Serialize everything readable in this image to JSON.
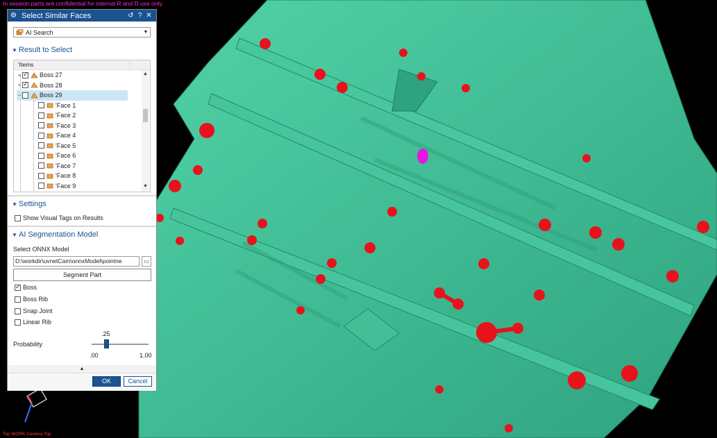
{
  "banner": "In session parts are confidential for internal R and D use only.",
  "viewport_label": "Top WORK Camera Top",
  "colors": {
    "model": "#3fc49a",
    "boss": "#e8121c",
    "selected_face": "#e317e3",
    "title": "#1b5391"
  },
  "dialog": {
    "title": "Select Similar Faces",
    "title_icons": [
      "gear-icon",
      "reset-icon",
      "help-icon",
      "close-icon"
    ],
    "help_glyph": "?",
    "close_glyph": "✕",
    "reset_glyph": "↺",
    "method": "AI Search",
    "result_section": "Result to Select",
    "tree_header": "'Items",
    "tree": [
      {
        "label": "Boss 27",
        "checked": true,
        "expander": "+"
      },
      {
        "label": "Boss 28",
        "checked": true,
        "expander": "+"
      },
      {
        "label": "Boss 29",
        "checked": false,
        "expander": "−",
        "selected": true
      },
      {
        "label": "'Face 1",
        "checked": false
      },
      {
        "label": "'Face 2",
        "checked": false
      },
      {
        "label": "'Face 3",
        "checked": false
      },
      {
        "label": "'Face 4",
        "checked": false
      },
      {
        "label": "'Face 5",
        "checked": false
      },
      {
        "label": "'Face 6",
        "checked": false
      },
      {
        "label": "'Face 7",
        "checked": false
      },
      {
        "label": "'Face 8",
        "checked": false
      },
      {
        "label": "'Face 9",
        "checked": false
      }
    ],
    "settings_section": "Settings",
    "show_visual_tags": "Show Visual Tags on Results",
    "seg_section": "AI Segmentation Model",
    "select_onnx_label": "Select ONNX Model",
    "onnx_path": "D:\\workdir\\uvnetCam\\onnxModel\\pointne",
    "segment_button": "Segment Part",
    "classes": [
      {
        "label": "Boss",
        "checked": true
      },
      {
        "label": "Boss Rib",
        "checked": false
      },
      {
        "label": "Snap Joint",
        "checked": false
      },
      {
        "label": "Linear Rib",
        "checked": false
      }
    ],
    "probability_label": "Probability",
    "probability_value": ".25",
    "probability_fraction": 0.25,
    "slider_min": ".00",
    "slider_max": "1.00",
    "ok": "OK",
    "cancel": "Cancel"
  }
}
